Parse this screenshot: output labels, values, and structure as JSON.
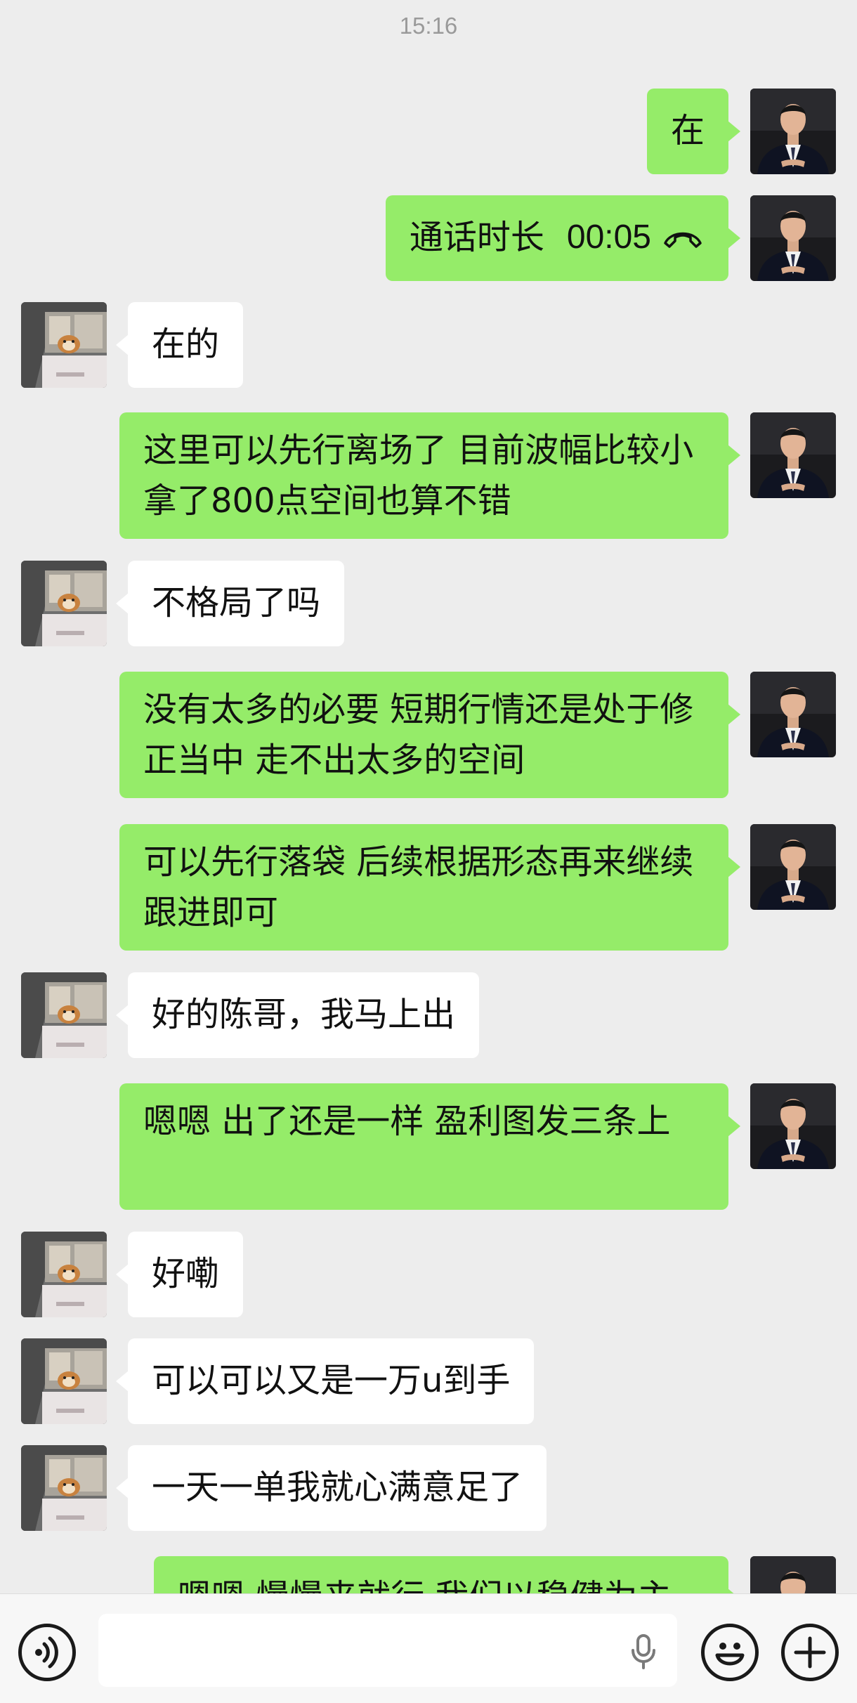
{
  "status_time": "15:16",
  "messages": [
    {
      "side": "me",
      "text": "在"
    },
    {
      "side": "me",
      "type": "call",
      "label": "通话时长",
      "duration": "00:05"
    },
    {
      "side": "other",
      "text": "在的"
    },
    {
      "side": "me",
      "text": "这里可以先行离场了 目前波幅比较小 拿了800点空间也算不错"
    },
    {
      "side": "other",
      "text": "不格局了吗"
    },
    {
      "side": "me",
      "text": "没有太多的必要 短期行情还是处于修正当中 走不出太多的空间"
    },
    {
      "side": "me",
      "text": "可以先行落袋 后续根据形态再来继续跟进即可"
    },
    {
      "side": "other",
      "text": "好的陈哥，我马上出"
    },
    {
      "side": "me",
      "text": "嗯嗯 出了还是一样 盈利图发三条上"
    },
    {
      "side": "other",
      "text": "好嘞"
    },
    {
      "side": "other",
      "text": "可以可以又是一万u到手"
    },
    {
      "side": "other",
      "text": "一天一单我就心满意足了"
    },
    {
      "side": "me",
      "text": "嗯嗯 慢慢来就行 我们以稳健为主",
      "partial": true
    }
  ],
  "input_bar": {
    "voice_icon": "voice-mode-icon",
    "mic_icon": "microphone-icon",
    "emoji_icon": "emoji-icon",
    "plus_icon": "plus-icon"
  },
  "colors": {
    "background": "#ededed",
    "self_bubble": "#95ec69",
    "other_bubble": "#ffffff",
    "input_bar": "#f7f7f7"
  }
}
